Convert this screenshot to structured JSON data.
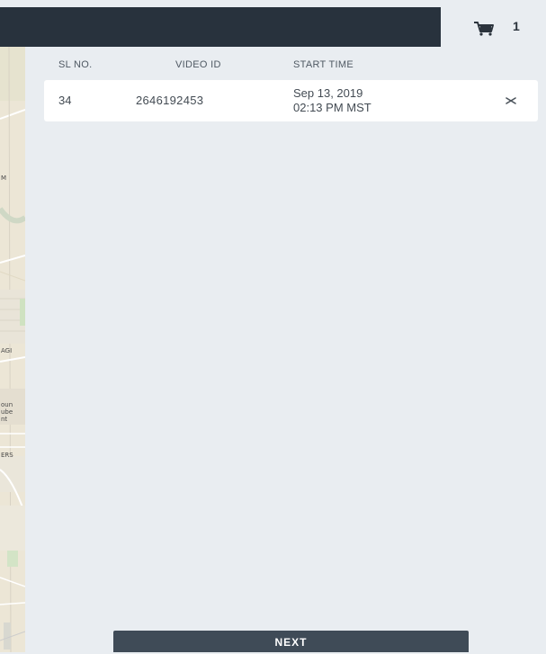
{
  "cart": {
    "icon": "cart-icon",
    "count": "1"
  },
  "table": {
    "headers": {
      "sl_no": "SL NO.",
      "video_id": "VIDEO ID",
      "start_time": "START TIME"
    },
    "rows": [
      {
        "sl_no": "34",
        "video_id": "2646192453",
        "start_date": "Sep 13, 2019",
        "start_clock": "02:13 PM MST",
        "remove_icon": "close-icon"
      }
    ]
  },
  "map": {
    "labels": [
      "M",
      "AGI",
      "oun\nube\nnt",
      "ERS"
    ]
  },
  "actions": {
    "next_label": "NEXT"
  },
  "colors": {
    "top_bar": "#28323d",
    "panel_bg": "#e9edf1",
    "button_bg": "#3f4b57",
    "row_bg": "#ffffff"
  }
}
